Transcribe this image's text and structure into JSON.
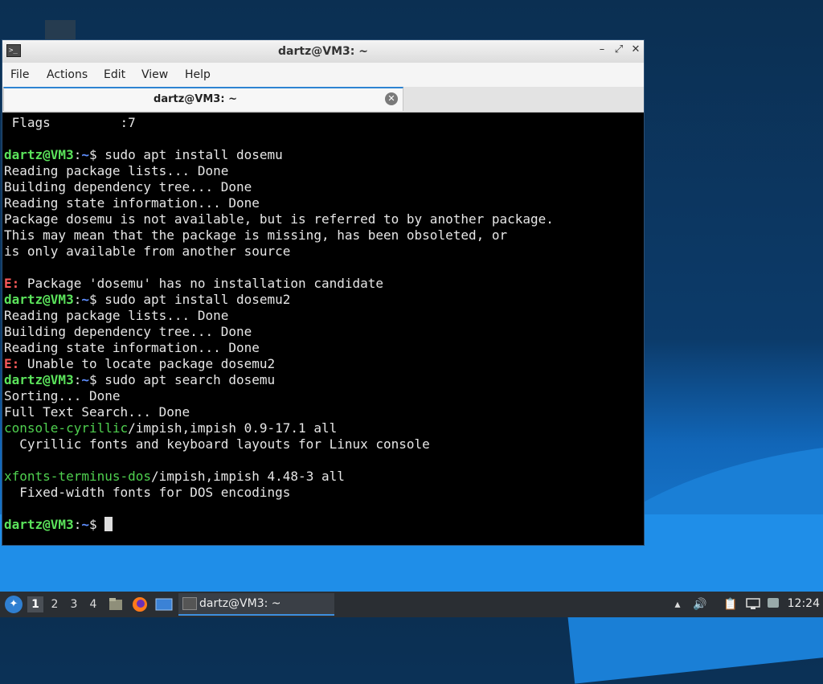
{
  "window": {
    "title": "dartz@VM3: ~",
    "controls": {
      "minimize": "–",
      "maximize": "⤢",
      "close": "✕"
    }
  },
  "menu": [
    "File",
    "Actions",
    "Edit",
    "View",
    "Help"
  ],
  "tab": {
    "label": "dartz@VM3: ~",
    "close": "✕"
  },
  "terminal": {
    "lines": [
      [
        {
          "t": " Flags         :7",
          "c": ""
        }
      ],
      [
        {
          "t": "",
          "c": ""
        }
      ],
      [
        {
          "t": "dartz@VM3",
          "c": "g"
        },
        {
          "t": ":",
          "c": ""
        },
        {
          "t": "~",
          "c": "b"
        },
        {
          "t": "$ sudo apt install dosemu",
          "c": ""
        }
      ],
      [
        {
          "t": "Reading package lists... Done",
          "c": ""
        }
      ],
      [
        {
          "t": "Building dependency tree... Done",
          "c": ""
        }
      ],
      [
        {
          "t": "Reading state information... Done",
          "c": ""
        }
      ],
      [
        {
          "t": "Package dosemu is not available, but is referred to by another package.",
          "c": ""
        }
      ],
      [
        {
          "t": "This may mean that the package is missing, has been obsoleted, or",
          "c": ""
        }
      ],
      [
        {
          "t": "is only available from another source",
          "c": ""
        }
      ],
      [
        {
          "t": "",
          "c": ""
        }
      ],
      [
        {
          "t": "E:",
          "c": "r"
        },
        {
          "t": " Package 'dosemu' has no installation candidate",
          "c": ""
        }
      ],
      [
        {
          "t": "dartz@VM3",
          "c": "g"
        },
        {
          "t": ":",
          "c": ""
        },
        {
          "t": "~",
          "c": "b"
        },
        {
          "t": "$ sudo apt install dosemu2",
          "c": ""
        }
      ],
      [
        {
          "t": "Reading package lists... Done",
          "c": ""
        }
      ],
      [
        {
          "t": "Building dependency tree... Done",
          "c": ""
        }
      ],
      [
        {
          "t": "Reading state information... Done",
          "c": ""
        }
      ],
      [
        {
          "t": "E:",
          "c": "r"
        },
        {
          "t": " Unable to locate package dosemu2",
          "c": ""
        }
      ],
      [
        {
          "t": "dartz@VM3",
          "c": "g"
        },
        {
          "t": ":",
          "c": ""
        },
        {
          "t": "~",
          "c": "b"
        },
        {
          "t": "$ sudo apt search dosemu",
          "c": ""
        }
      ],
      [
        {
          "t": "Sorting... Done",
          "c": ""
        }
      ],
      [
        {
          "t": "Full Text Search... Done",
          "c": ""
        }
      ],
      [
        {
          "t": "console-cyrillic",
          "c": "pk"
        },
        {
          "t": "/impish,impish 0.9-17.1 all",
          "c": ""
        }
      ],
      [
        {
          "t": "  Cyrillic fonts and keyboard layouts for Linux console",
          "c": ""
        }
      ],
      [
        {
          "t": "",
          "c": ""
        }
      ],
      [
        {
          "t": "xfonts-terminus-dos",
          "c": "pk"
        },
        {
          "t": "/impish,impish 4.48-3 all",
          "c": ""
        }
      ],
      [
        {
          "t": "  Fixed-width fonts for DOS encodings",
          "c": ""
        }
      ],
      [
        {
          "t": "",
          "c": ""
        }
      ],
      [
        {
          "t": "dartz@VM3",
          "c": "g"
        },
        {
          "t": ":",
          "c": ""
        },
        {
          "t": "~",
          "c": "b"
        },
        {
          "t": "$ ",
          "c": ""
        },
        {
          "cursor": true
        }
      ]
    ]
  },
  "taskbar": {
    "workspaces": [
      "1",
      "2",
      "3",
      "4"
    ],
    "task_label": "dartz@VM3: ~",
    "clock": "12:24"
  }
}
